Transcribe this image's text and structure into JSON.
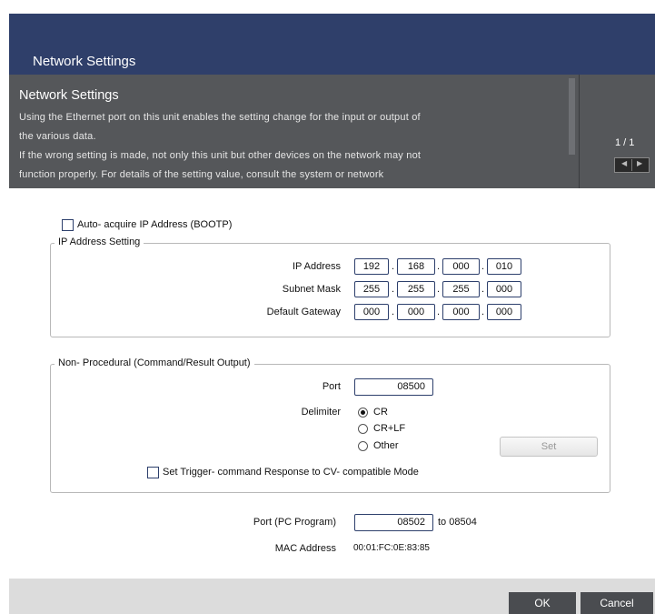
{
  "dialog": {
    "title": "Network Settings"
  },
  "help": {
    "title": "Network Settings",
    "lines": [
      "Using the Ethernet port on this unit enables the setting change for the input or output of",
      "the various data.",
      "If the wrong setting is made, not only this unit but other devices on the network may not",
      "function properly.  For details of the setting value, consult the system or network"
    ],
    "page_indicator": "1 / 1",
    "prev_glyph": "◀",
    "next_glyph": "▶"
  },
  "auto_acquire": {
    "label": "Auto- acquire IP Address (BOOTP)",
    "checked": false
  },
  "ip_setting": {
    "group_title": "IP Address Setting",
    "ip_address": {
      "label": "IP Address",
      "octets": [
        "192",
        "168",
        "000",
        "010"
      ]
    },
    "subnet_mask": {
      "label": "Subnet Mask",
      "octets": [
        "255",
        "255",
        "255",
        "000"
      ]
    },
    "default_gateway": {
      "label": "Default Gateway",
      "octets": [
        "000",
        "000",
        "000",
        "000"
      ]
    },
    "separator": "."
  },
  "non_procedural": {
    "group_title": "Non- Procedural (Command/Result Output)",
    "port_label": "Port",
    "port_value": "08500",
    "delimiter_label": "Delimiter",
    "delimiter_options": [
      "CR",
      "CR+LF",
      "Other"
    ],
    "delimiter_selected": "CR",
    "set_button": "Set",
    "trigger_label": "Set Trigger- command Response to CV- compatible Mode",
    "trigger_checked": false
  },
  "pc_program": {
    "label": "Port (PC Program)",
    "port_value": "08502",
    "to_text": "to 08504"
  },
  "mac": {
    "label": "MAC Address",
    "value": "00:01:FC:0E:83:85"
  },
  "footer": {
    "ok": "OK",
    "cancel": "Cancel"
  }
}
